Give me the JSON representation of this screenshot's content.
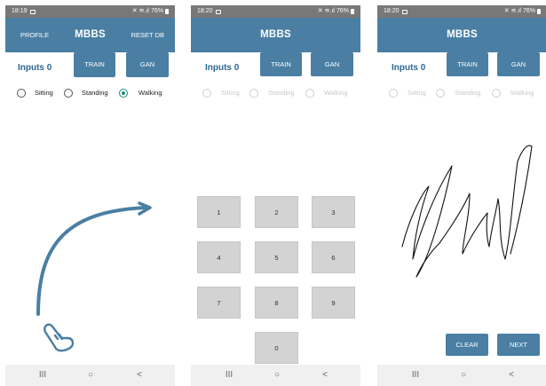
{
  "screens": [
    {
      "status_time": "18:19",
      "status_right": "76%",
      "title": "MBBS",
      "profile_label": "PROFILE",
      "reset_label": "RESET DB",
      "inputs_label": "Inputs 0",
      "train_label": "TRAIN",
      "gan_label": "GAN",
      "radios": [
        "Sitting",
        "Standing",
        "Walking"
      ],
      "selected_radio": "Walking",
      "gesture_icons": [
        "curved-arrow-icon",
        "swipe-hand-icon"
      ]
    },
    {
      "status_time": "18:20",
      "status_right": "76%",
      "title": "MBBS",
      "inputs_label": "Inputs 0",
      "train_label": "TRAIN",
      "gan_label": "GAN",
      "radios": [
        "Sitting",
        "Standing",
        "Walking"
      ],
      "keypad": [
        "1",
        "2",
        "3",
        "4",
        "5",
        "6",
        "7",
        "8",
        "9",
        "0"
      ]
    },
    {
      "status_time": "18:20",
      "status_right": "76%",
      "title": "MBBS",
      "inputs_label": "Inputs 0",
      "train_label": "TRAIN",
      "gan_label": "GAN",
      "radios": [
        "Sitting",
        "Standing",
        "Walking"
      ],
      "clear_label": "CLEAR",
      "next_label": "NEXT",
      "drawing": "signature-stroke"
    }
  ],
  "nav": {
    "recents": "III",
    "home": "○",
    "back": "<"
  },
  "colors": {
    "accent": "#4a7fa3",
    "label": "#2d6793",
    "radio_checked": "#1a8f80",
    "key": "#d3d3d3",
    "status": "#787878"
  }
}
